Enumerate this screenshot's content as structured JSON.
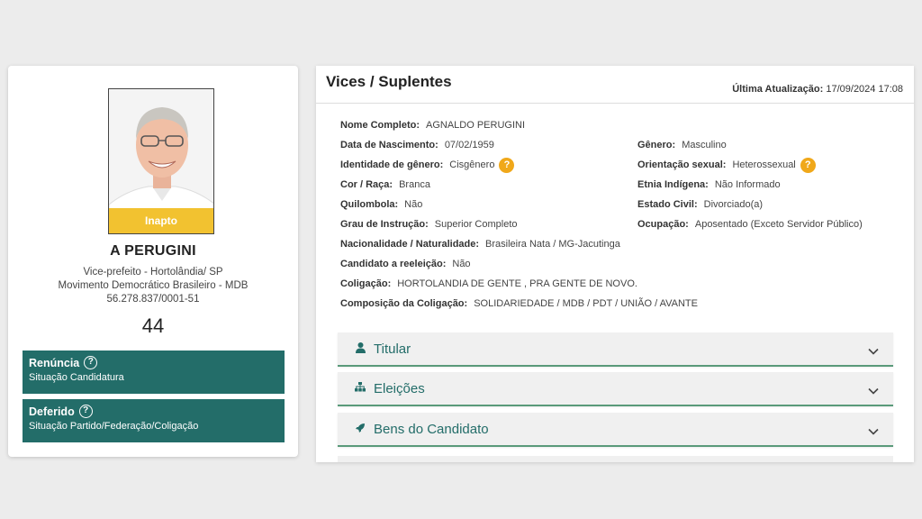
{
  "candidate": {
    "photo_status": "Inapto",
    "name": "A PERUGINI",
    "role": "Vice-prefeito - Hortolândia/ SP",
    "party": "Movimento Democrático Brasileiro - MDB",
    "cnpj": "56.278.837/0001-51",
    "number": "44",
    "status_boxes": [
      {
        "title": "Renúncia",
        "subtitle": "Situação Candidatura"
      },
      {
        "title": "Deferido",
        "subtitle": "Situação Partido/Federação/Coligação"
      }
    ]
  },
  "panel": {
    "title": "Vices / Suplentes",
    "updated_label": "Última Atualização:",
    "updated_value": "17/09/2024 17:08"
  },
  "details": {
    "nome_label": "Nome Completo:",
    "nome": "AGNALDO PERUGINI",
    "nascimento_label": "Data de Nascimento:",
    "nascimento": "07/02/1959",
    "genero_label": "Gênero:",
    "genero": "Masculino",
    "identidade_label": "Identidade de gênero:",
    "identidade": "Cisgênero",
    "orientacao_label": "Orientação sexual:",
    "orientacao": "Heterossexual",
    "cor_label": "Cor / Raça:",
    "cor": "Branca",
    "etnia_label": "Etnia Indígena:",
    "etnia": "Não Informado",
    "quilombola_label": "Quilombola:",
    "quilombola": "Não",
    "estado_civil_label": "Estado Civil:",
    "estado_civil": "Divorciado(a)",
    "instrucao_label": "Grau de Instrução:",
    "instrucao": "Superior Completo",
    "ocupacao_label": "Ocupação:",
    "ocupacao": "Aposentado (Exceto Servidor Público)",
    "nacionalidade_label": "Nacionalidade / Naturalidade:",
    "nacionalidade": "Brasileira Nata / MG-Jacutinga",
    "reeleicao_label": "Candidato a reeleição:",
    "reeleicao": "Não",
    "coligacao_label": "Coligação:",
    "coligacao": "HORTOLANDIA DE GENTE , PRA GENTE DE NOVO.",
    "composicao_label": "Composição da Coligação:",
    "composicao": "SOLIDARIEDADE / MDB / PDT / UNIÃO / AVANTE",
    "help_mark": "?"
  },
  "accordions": [
    {
      "label": "Titular",
      "icon": "person-icon"
    },
    {
      "label": "Eleições",
      "icon": "sitemap-icon"
    },
    {
      "label": "Bens do Candidato",
      "icon": "rocket-icon"
    }
  ],
  "colors": {
    "accent": "#236d69",
    "warning": "#f2c230",
    "help": "#f0a81a"
  }
}
